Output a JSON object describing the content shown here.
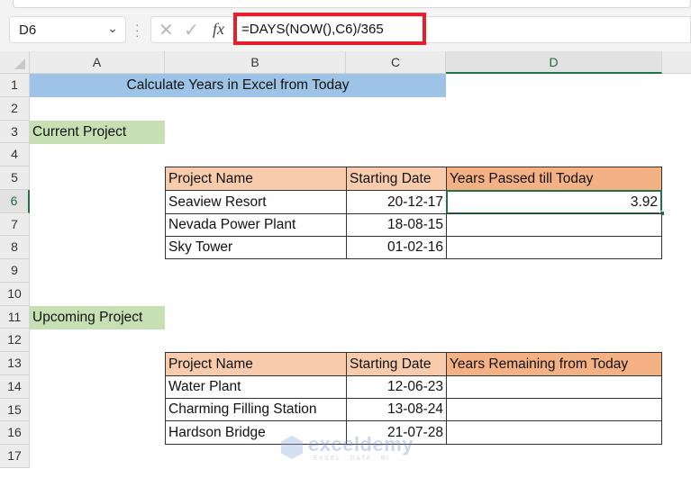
{
  "name_box": {
    "value": "D6"
  },
  "formula_bar": {
    "cancel_icon": "x-icon",
    "enter_icon": "check-icon",
    "fx_label": "fx",
    "formula": "=DAYS(NOW(),C6)/365"
  },
  "columns": [
    "A",
    "B",
    "C",
    "D"
  ],
  "selected_column": "D",
  "rows": [
    "1",
    "2",
    "3",
    "4",
    "5",
    "6",
    "7",
    "8",
    "9",
    "10",
    "11",
    "12",
    "13",
    "14",
    "15",
    "16",
    "17"
  ],
  "selected_row": "6",
  "sheet": {
    "title": "Calculate Years in Excel from Today",
    "current_section": "Current Project",
    "upcoming_section": "Upcoming Project",
    "current_table": {
      "headers": [
        "Project Name",
        "Starting Date",
        "Years Passed till Today"
      ],
      "rows": [
        {
          "name": "Seaview Resort",
          "date": "20-12-17",
          "value": "3.92"
        },
        {
          "name": "Nevada Power Plant",
          "date": "18-08-15",
          "value": ""
        },
        {
          "name": "Sky Tower",
          "date": "01-02-16",
          "value": ""
        }
      ]
    },
    "upcoming_table": {
      "headers": [
        "Project Name",
        "Starting Date",
        "Years Remaining from Today"
      ],
      "rows": [
        {
          "name": "Water Plant",
          "date": "12-06-23",
          "value": ""
        },
        {
          "name": "Charming Filling Station",
          "date": "13-08-24",
          "value": ""
        },
        {
          "name": "Hardson Bridge",
          "date": "21-07-28",
          "value": ""
        }
      ]
    }
  },
  "watermark": {
    "name": "exceldemy",
    "tagline": "EXCEL · DATA · BI"
  },
  "colors": {
    "accent": "#217346",
    "highlight_border": "#e5202a",
    "title_fill": "#9dc3e6",
    "section_fill": "#c6e0b4",
    "header_fill": "#f8cbad",
    "header_fill_last": "#f4b183"
  }
}
